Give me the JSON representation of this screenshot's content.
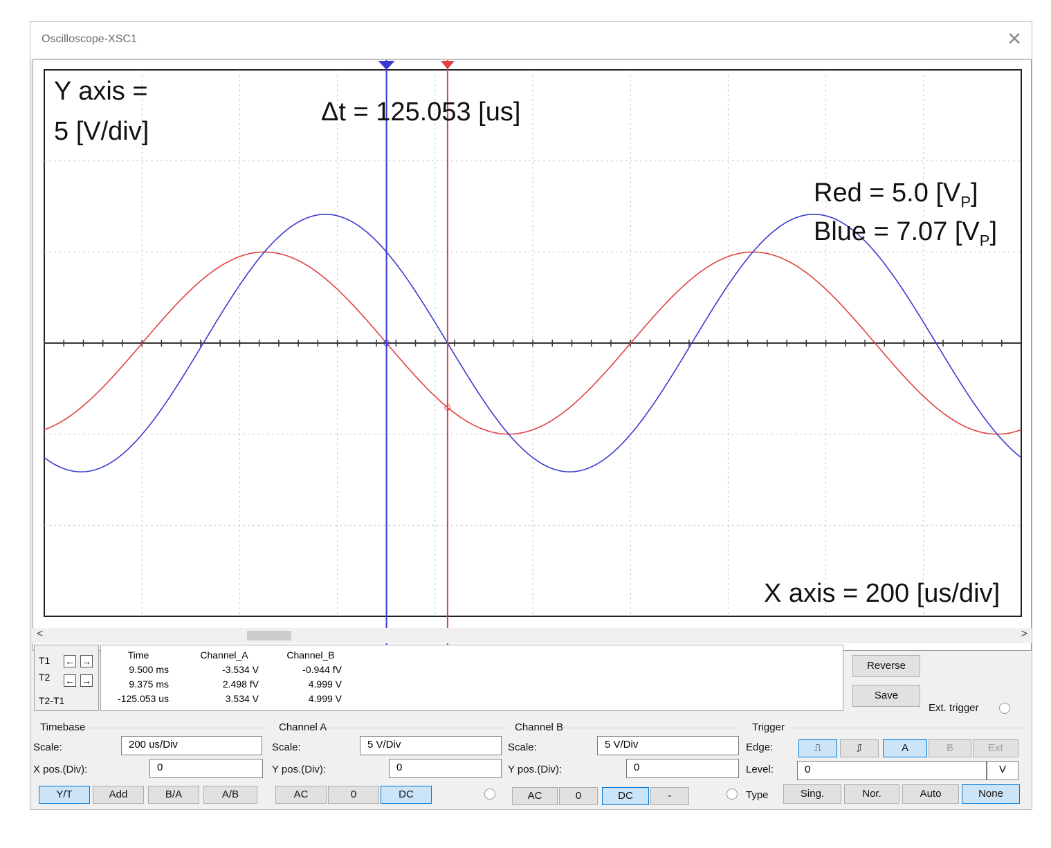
{
  "window": {
    "title": "Oscilloscope-XSC1",
    "close_icon": "close-icon"
  },
  "screen": {
    "annotations": {
      "y_axis_line1": "Y axis =",
      "y_axis_line2": "5 [V/div]",
      "delta_t": "Δt = 125.053 [us]",
      "red_label": "Red = 5.0 [V",
      "red_sub": "P",
      "red_close": "]",
      "blue_label": "Blue = 7.07 [V",
      "blue_sub": "P",
      "blue_close": "]",
      "x_axis": "X axis = 200 [us/div]"
    },
    "colors": {
      "channel_a": "#e04040",
      "channel_b": "#3a3ad0",
      "grid": "#c8c8c8",
      "axis": "#333333"
    },
    "traces": {
      "time_per_div_us": 200,
      "volts_per_div": 5,
      "channel_a_peak_v": 5.0,
      "channel_b_peak_v": 7.07,
      "period_us": 1000,
      "cursor_t1_ms": 9.5,
      "cursor_t2_ms": 9.375
    }
  },
  "cursors": {
    "t1_label": "T1",
    "t2_label": "T2",
    "diff_label": "T2-T1"
  },
  "readout": {
    "headers": [
      "Time",
      "Channel_A",
      "Channel_B"
    ],
    "rows": [
      [
        "9.500 ms",
        "-3.534 V",
        "-0.944 fV"
      ],
      [
        "9.375 ms",
        "2.498 fV",
        "4.999 V"
      ],
      [
        "-125.053 us",
        "3.534 V",
        "4.999 V"
      ]
    ]
  },
  "side_buttons": {
    "reverse": "Reverse",
    "save": "Save",
    "ext_trigger": "Ext. trigger"
  },
  "timebase": {
    "title": "Timebase",
    "scale_label": "Scale:",
    "scale_value": "200 us/Div",
    "xpos_label": "X pos.(Div):",
    "xpos_value": "0",
    "buttons": [
      "Y/T",
      "Add",
      "B/A",
      "A/B"
    ]
  },
  "channel_a": {
    "title": "Channel A",
    "scale_label": "Scale:",
    "scale_value": "5  V/Div",
    "ypos_label": "Y pos.(Div):",
    "ypos_value": "0",
    "buttons": [
      "AC",
      "0",
      "DC"
    ]
  },
  "channel_b": {
    "title": "Channel B",
    "scale_label": "Scale:",
    "scale_value": "5  V/Div",
    "ypos_label": "Y pos.(Div):",
    "ypos_value": "0",
    "buttons": [
      "AC",
      "0",
      "DC",
      "-"
    ]
  },
  "trigger": {
    "title": "Trigger",
    "edge_label": "Edge:",
    "level_label": "Level:",
    "level_value": "0",
    "level_unit": "V",
    "type_label": "Type",
    "edge_buttons": [
      "A",
      "B",
      "Ext"
    ],
    "type_buttons": [
      "Sing.",
      "Nor.",
      "Auto",
      "None"
    ]
  }
}
